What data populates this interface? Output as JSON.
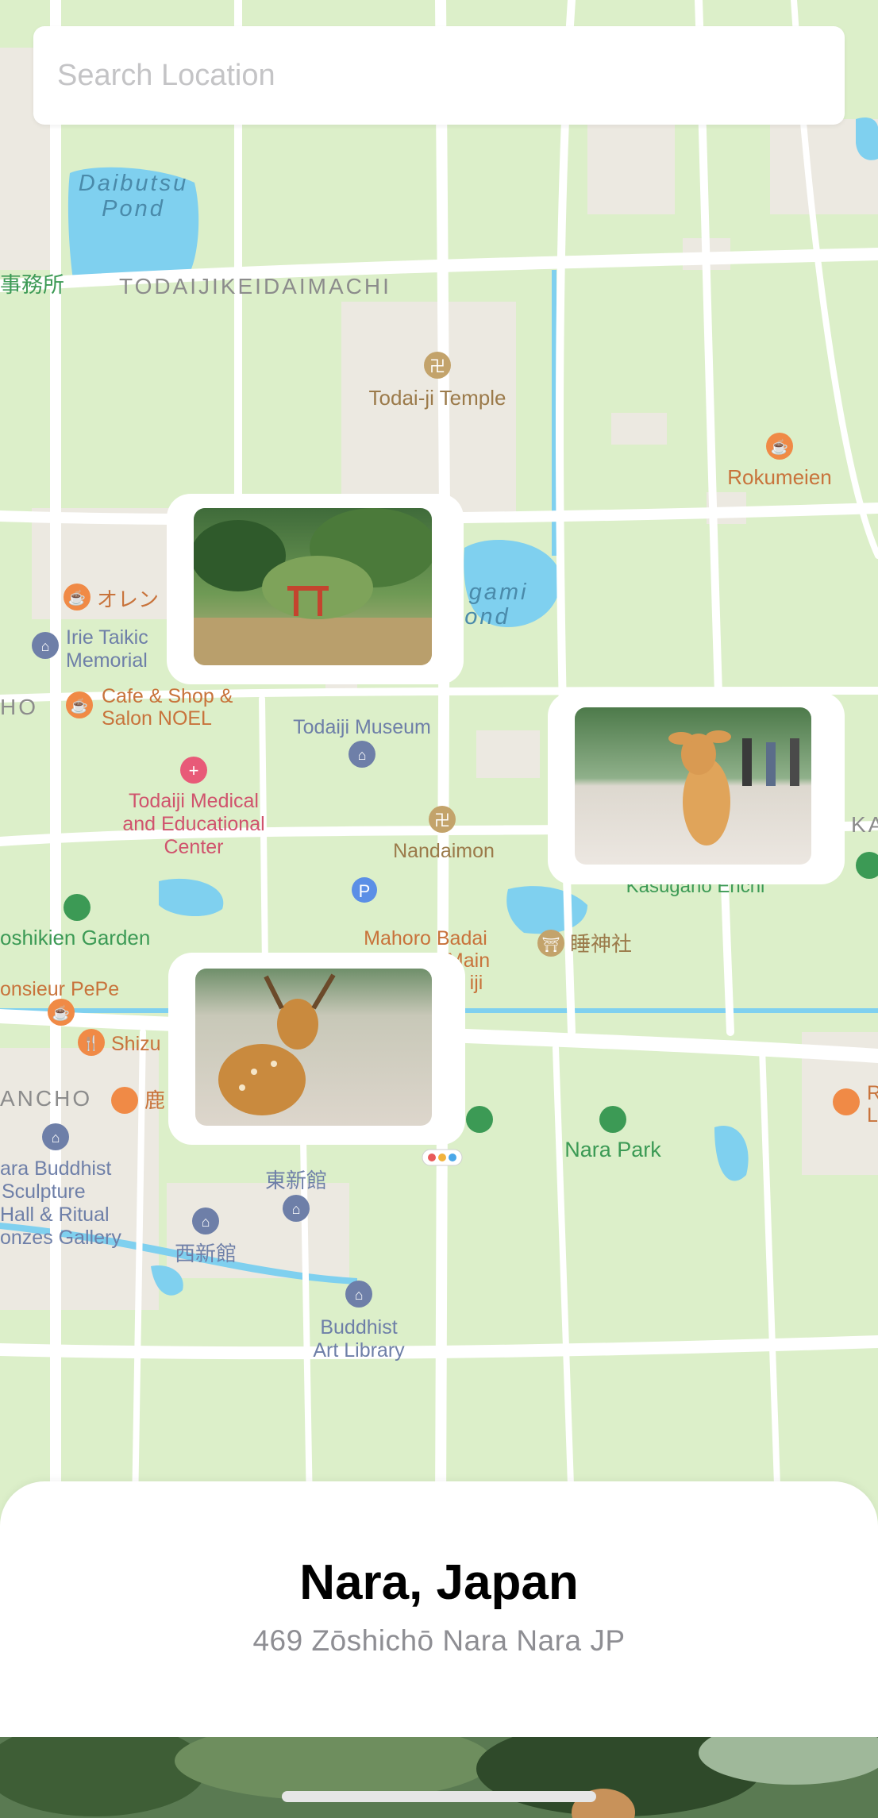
{
  "search": {
    "placeholder": "Search Location"
  },
  "map": {
    "labels": {
      "daibutsu_pond": [
        "Daibutsu",
        "Pond"
      ],
      "todaijikeidaimachi": "TODAIJIKEIDAIMACHI",
      "office_fragment": "事務所",
      "todaiji_temple": "Todai-ji Temple",
      "rokumeien": "Rokumeien",
      "kagami_pond": [
        "gami",
        "ond"
      ],
      "orange_fragment": "オレン",
      "irie_taikichi": [
        "Irie Taikic",
        "Memorial"
      ],
      "cafe_shop": [
        "Cafe & Shop &",
        "Salon NOEL"
      ],
      "ho_fragment": "HO",
      "todaiji_museum": "Todaiji Museum",
      "todaiji_medical": [
        "Todaiji Medical",
        "and Educational",
        "Center"
      ],
      "nandaimon": "Nandaimon",
      "ka_fragment": "KA",
      "kasugano": "Kasugano Enchi",
      "yoshikien": "oshikien Garden",
      "mahoro": [
        "Mahoro Badai",
        "Main",
        "iji"
      ],
      "shrine_jp": "睡神社",
      "monsieur": "onsieur PePe",
      "shizu": "Shizu",
      "ancho": "ANCHO",
      "shika_jp": "鹿",
      "nara_park": "Nara Park",
      "r_fragment": [
        "R",
        "L"
      ],
      "nara_buddhist": [
        "ara Buddhist",
        "Sculpture",
        "Hall & Ritual",
        "onzes Gallery"
      ],
      "east_hall_jp": "東新館",
      "west_hall_jp": "西新館",
      "buddhist_art": [
        "Buddhist",
        "Art Library"
      ],
      "parking": "P"
    },
    "pins": [
      {
        "subject": "torii gate reflected in pond"
      },
      {
        "subject": "young deer in park"
      },
      {
        "subject": "antlered deer"
      }
    ],
    "colors": {
      "land": "#dcefc9",
      "road": "#ffffff",
      "water": "#7fd0ef",
      "block": "#ece9e1",
      "brown_label": "#9b7a4a",
      "orange_label": "#c8733b",
      "blue_label": "#6e7fa8",
      "pink_label": "#d0536d",
      "green_label": "#3c9a55"
    }
  },
  "location": {
    "title": "Nara, Japan",
    "address": "469 Zōshichō Nara Nara JP"
  }
}
